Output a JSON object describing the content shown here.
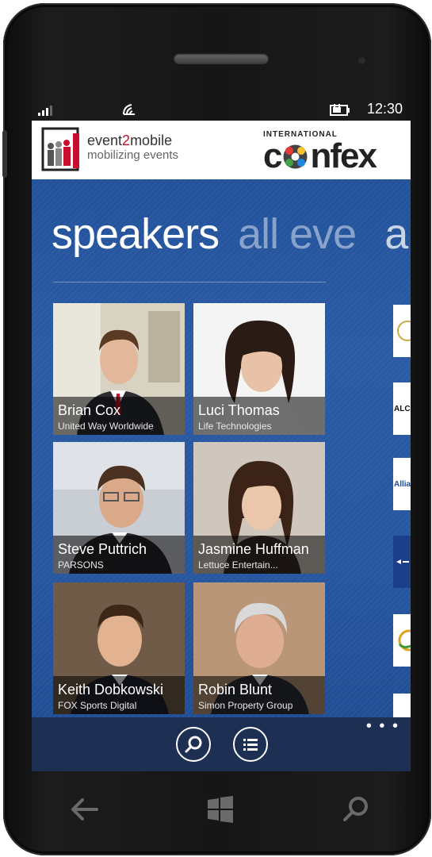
{
  "status_bar": {
    "time": "12:30",
    "signal_icon": "signal-icon",
    "wifi_icon": "wifi-icon",
    "battery_icon": "battery-charging-icon"
  },
  "banner": {
    "brand_title_part1": "event",
    "brand_title_part2": "2",
    "brand_title_part3": "mobile",
    "brand_tagline": "mobilizing events",
    "sponsor_top": "INTERNATIONAL",
    "sponsor_c": "c",
    "sponsor_rest": "nfex"
  },
  "pivot": {
    "active": "speakers",
    "next": "all eve",
    "third": "a"
  },
  "speakers": [
    {
      "name": "Brian Cox",
      "org": "United Way Worldwide"
    },
    {
      "name": "Luci Thomas",
      "org": "Life Technologies"
    },
    {
      "name": "Steve Puttrich",
      "org": "PARSONS"
    },
    {
      "name": "Jasmine Huffman",
      "org": "Lettuce Entertain..."
    },
    {
      "name": "Keith Dobkowski",
      "org": "FOX Sports Digital"
    },
    {
      "name": "Robin Blunt",
      "org": "Simon Property Group"
    }
  ],
  "sponsors_peek": [
    "",
    "ALC",
    "Allian",
    "",
    "",
    ""
  ],
  "appbar": {
    "search_icon": "search-icon",
    "list_icon": "list-icon",
    "more": "• • •"
  },
  "hardware_nav": {
    "back_icon": "back-arrow-icon",
    "start_icon": "windows-start-icon",
    "search_icon": "search-icon"
  },
  "colors": {
    "pivot_bg": "#2656a0",
    "appbar_bg": "#1d3054",
    "accent_red": "#c8102e"
  }
}
